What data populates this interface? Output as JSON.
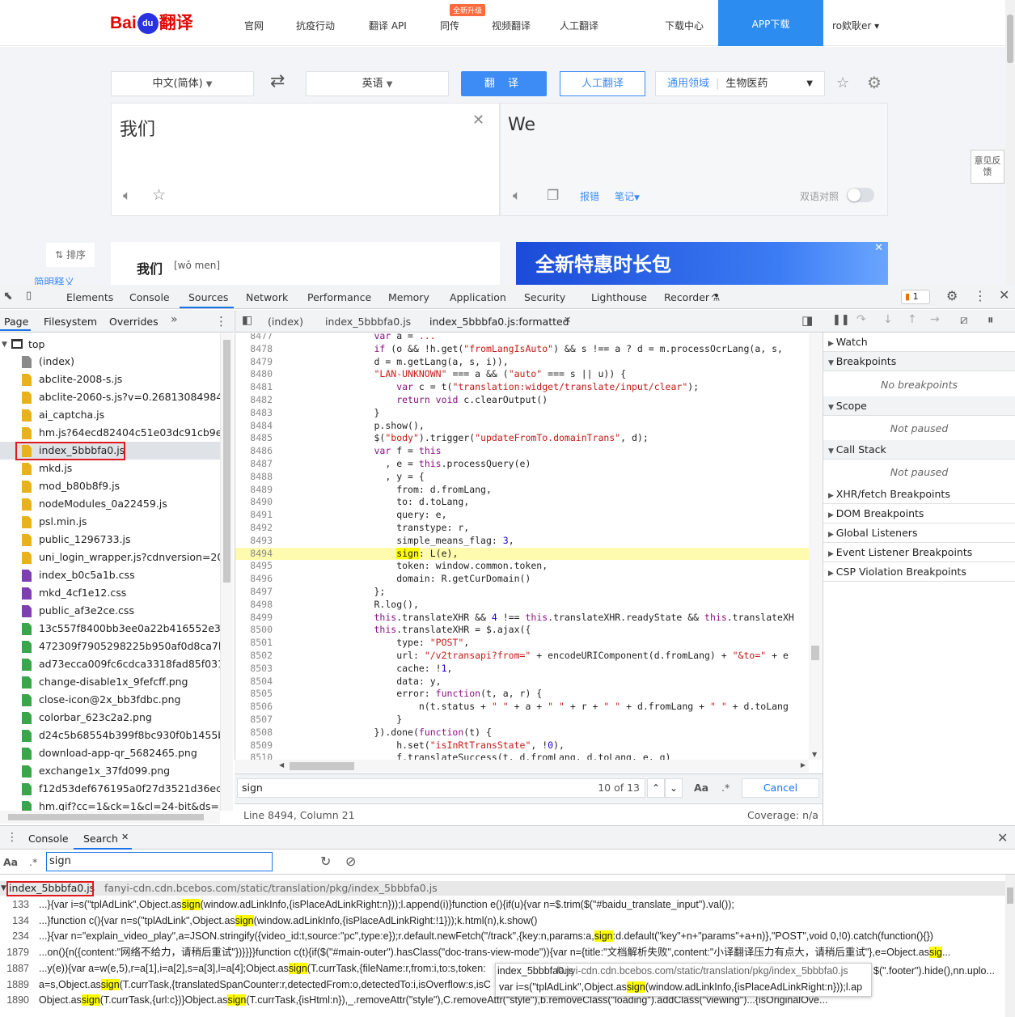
{
  "baidu": {
    "logo_text": "Bai",
    "logo_paw": "du",
    "logo_fanyi": "翻译",
    "nav": [
      "官网",
      "抗疫行动",
      "翻译 API",
      "同传",
      "视频翻译",
      "人工翻译",
      "下载中心"
    ],
    "new_badge": "全新升级",
    "app_download": "APP下载",
    "user": "ro欸耿er",
    "src_lang": "中文(简体)",
    "tgt_lang": "英语",
    "translate_btn": "翻 译",
    "human_btn": "人工翻译",
    "domain_label": "通用领域",
    "domain_value": "生物医药",
    "src_text": "我们",
    "tgt_text": "We",
    "report": "报错",
    "notes": "笔记",
    "bilingual": "双语对照",
    "feedback": "意见反馈",
    "sort": "排序",
    "brief": "简明释义",
    "dict_word": "我们",
    "dict_pinyin": "[wǒ men]",
    "ad_text": "全新特惠时长包"
  },
  "devtools": {
    "tabs": [
      "Elements",
      "Console",
      "Sources",
      "Network",
      "Performance",
      "Memory",
      "Application",
      "Security",
      "Lighthouse",
      "Recorder"
    ],
    "active_tab": "Sources",
    "issues_count": "1",
    "nav_tabs": [
      "Page",
      "Filesystem",
      "Overrides"
    ],
    "tree_root": "top",
    "files": [
      {
        "name": "(index)",
        "type": "doc"
      },
      {
        "name": "abclite-2008-s.js",
        "type": "js"
      },
      {
        "name": "abclite-2060-s.js?v=0.26813084984751",
        "type": "js"
      },
      {
        "name": "ai_captcha.js",
        "type": "js"
      },
      {
        "name": "hm.js?64ecd82404c51e03dc91cb9e8c0",
        "type": "js"
      },
      {
        "name": "index_5bbbfa0.js",
        "type": "js",
        "selected": true
      },
      {
        "name": "mkd.js",
        "type": "js"
      },
      {
        "name": "mod_b80b8f9.js",
        "type": "js"
      },
      {
        "name": "nodeModules_0a22459.js",
        "type": "js"
      },
      {
        "name": "psl.min.js",
        "type": "js"
      },
      {
        "name": "public_1296733.js",
        "type": "js"
      },
      {
        "name": "uni_login_wrapper.js?cdnversion=2022",
        "type": "js"
      },
      {
        "name": "index_b0c5a1b.css",
        "type": "css"
      },
      {
        "name": "mkd_4cf1e12.css",
        "type": "css"
      },
      {
        "name": "public_af3e2ce.css",
        "type": "css"
      },
      {
        "name": "13c557f8400bb3ee0a22b416552e3618",
        "type": "img"
      },
      {
        "name": "472309f7905298225b950af0d8ca7bcb",
        "type": "img"
      },
      {
        "name": "ad73ecca009fc6cdca3318fad85f0314.jp",
        "type": "img"
      },
      {
        "name": "change-disable1x_9fefcff.png",
        "type": "img"
      },
      {
        "name": "close-icon@2x_bb3fdbc.png",
        "type": "img"
      },
      {
        "name": "colorbar_623c2a2.png",
        "type": "img"
      },
      {
        "name": "d24c5b68554b399f8bc930f0b1455b67",
        "type": "img"
      },
      {
        "name": "download-app-qr_5682465.png",
        "type": "img"
      },
      {
        "name": "exchange1x_37fd099.png",
        "type": "img"
      },
      {
        "name": "f12d53def676195a0f27d3521d36ecbb.",
        "type": "img"
      },
      {
        "name": "hm.gif?cc=1&ck=1&cl=24-bit&ds=25",
        "type": "img"
      }
    ],
    "editor_tabs": [
      "(index)",
      "index_5bbbfa0.js",
      "index_5bbbfa0.js:formatted"
    ],
    "code_lines": [
      {
        "n": "8477",
        "html": "<span class='kw'>var</span> a = <span class='str'>...</span>",
        "cut": true
      },
      {
        "n": "8478",
        "html": "<span class='kw'>if</span> (o &amp;&amp; !h.get(<span class='str'>\"fromLangIsAuto\"</span>) &amp;&amp; s !== a ? d = m.processOcrLang(a, s,"
      },
      {
        "n": "8479",
        "html": "d = m.getLang(a, s, i)),"
      },
      {
        "n": "8480",
        "html": "<span class='str'>\"LAN-UNKNOWN\"</span> === a &amp;&amp; (<span class='str'>\"auto\"</span> === s || u)) {"
      },
      {
        "n": "8481",
        "html": "    <span class='kw'>var</span> c = t(<span class='str'>\"translation:widget/translate/input/clear\"</span>);"
      },
      {
        "n": "8482",
        "html": "    <span class='kw'>return void</span> c.clearOutput()"
      },
      {
        "n": "8483",
        "html": "}"
      },
      {
        "n": "8484",
        "html": "p.show(),"
      },
      {
        "n": "8485",
        "html": "$(<span class='str'>\"body\"</span>).trigger(<span class='str'>\"updateFromTo.domainTrans\"</span>, d);"
      },
      {
        "n": "8486",
        "html": "<span class='kw'>var</span> f = <span class='kw'>this</span>"
      },
      {
        "n": "8487",
        "html": "  , e = <span class='kw'>this</span>.processQuery(e)"
      },
      {
        "n": "8488",
        "html": "  , y = {"
      },
      {
        "n": "8489",
        "html": "    from: d.fromLang,"
      },
      {
        "n": "8490",
        "html": "    to: d.toLang,"
      },
      {
        "n": "8491",
        "html": "    query: e,"
      },
      {
        "n": "8492",
        "html": "    transtype: r,"
      },
      {
        "n": "8493",
        "html": "    simple_means_flag: <span class='num'>3</span>,"
      },
      {
        "n": "8494",
        "html": "    <span class='mark'>sign</span>: L(e),",
        "hl": true
      },
      {
        "n": "8495",
        "html": "    token: window.common.token,"
      },
      {
        "n": "8496",
        "html": "    domain: R.getCurDomain()"
      },
      {
        "n": "8497",
        "html": "};"
      },
      {
        "n": "8498",
        "html": "R.log(),"
      },
      {
        "n": "8499",
        "html": "<span class='kw'>this</span>.translateXHR &amp;&amp; <span class='num'>4</span> !== <span class='kw'>this</span>.translateXHR.readyState &amp;&amp; <span class='kw'>this</span>.translateXH"
      },
      {
        "n": "8500",
        "html": "<span class='kw'>this</span>.translateXHR = $.ajax({"
      },
      {
        "n": "8501",
        "html": "    type: <span class='str'>\"POST\"</span>,"
      },
      {
        "n": "8502",
        "html": "    url: <span class='str'>\"/v2transapi?from=\"</span> + encodeURIComponent(d.fromLang) + <span class='str'>\"&amp;to=\"</span> + e"
      },
      {
        "n": "8503",
        "html": "    cache: !<span class='num'>1</span>,"
      },
      {
        "n": "8504",
        "html": "    data: y,"
      },
      {
        "n": "8505",
        "html": "    error: <span class='kw'>function</span>(t, a, r) {"
      },
      {
        "n": "8506",
        "html": "        n(t.status + <span class='str'>\" \"</span> + a + <span class='str'>\" \"</span> + r + <span class='str'>\" \"</span> + d.fromLang + <span class='str'>\" \"</span> + d.toLang"
      },
      {
        "n": "8507",
        "html": "    }"
      },
      {
        "n": "8508",
        "html": "}).done(<span class='kw'>function</span>(t) {"
      },
      {
        "n": "8509",
        "html": "    h.set(<span class='str'>\"isInRtTransState\"</span>, !<span class='num'>0</span>),"
      },
      {
        "n": "8510",
        "html": "    f.translateSuccess(t, d.fromLang, d.toLang, e, g)"
      },
      {
        "n": "8511",
        "html": ""
      }
    ],
    "find_query": "sign",
    "find_count": "10 of 13",
    "find_cancel": "Cancel",
    "status_pos": "Line 8494, Column 21",
    "status_cov": "Coverage: n/a",
    "sections": [
      {
        "label": "Watch",
        "open": false
      },
      {
        "label": "Breakpoints",
        "open": true,
        "note": "No breakpoints"
      },
      {
        "label": "Scope",
        "open": true,
        "note": "Not paused"
      },
      {
        "label": "Call Stack",
        "open": true,
        "note": "Not paused"
      },
      {
        "label": "XHR/fetch Breakpoints",
        "open": false
      },
      {
        "label": "DOM Breakpoints",
        "open": false
      },
      {
        "label": "Global Listeners",
        "open": false
      },
      {
        "label": "Event Listener Breakpoints",
        "open": false
      },
      {
        "label": "CSP Violation Breakpoints",
        "open": false
      }
    ],
    "drawer_tabs": [
      "Console",
      "Search"
    ],
    "search_query": "sign",
    "result_file": "index_5bbbfa0.js",
    "result_url": "fanyi-cdn.cdn.bcebos.com/static/translation/pkg/index_5bbbfa0.js",
    "results": [
      {
        "n": "133",
        "html": "...}{var i=s(\"tplAdLink\",Object.as<span class='mark'>sign</span>(window.adLinkInfo,{isPlaceAdLinkRight:n}));l.append(i)}function e(){if(u){var n=$.trim($(\"#baidu_translate_input\").val());"
      },
      {
        "n": "134",
        "html": "...}function c(){var n=s(\"tplAdLink\",Object.as<span class='mark'>sign</span>(window.adLinkInfo,{isPlaceAdLinkRight:!1}));k.html(n),k.show()"
      },
      {
        "n": "234",
        "html": "...}{var n=\"explain_video_play\",a=JSON.stringify({video_id:t,source:\"pc\",type:e});r.default.newFetch(\"/track\",{key:n,params:a,<span class='mark'>sign</span>:d.default(\"key\"+n+\"params\"+a+n)},\"POST\",void 0,!0).catch(function(){})"
      },
      {
        "n": "1879",
        "html": "...on(){n({content:\"网络不给力，请稍后重试\"})}}}}function c(t){if($(\"#main-outer\").hasClass(\"doc-trans-view-mode\")){var n={title:\"文档解析失败\",content:\"小译翻译压力有点大，请稍后重试\"},e=Object.as<span class='mark'>sig</span>..."
      },
      {
        "n": "1887",
        "html": "...y(e)){var a=w(e,5),r=a[1],i=a[2],s=a[3],l=a[4];Object.as<span class='mark'>sign</span>(T.currTask,{fileName:r,from:i,to:s,token:"
      },
      {
        "n": "1889",
        "html": "a=s,Object.as<span class='mark'>sign</span>(T.currTask,{translatedSpanCounter:r,detectedFrom:o,detectedTo:i,isOverflow:s,isC"
      },
      {
        "n": "1890",
        "html": "Object.as<span class='mark'>sign</span>(T.currTask,{url:c})}Object.as<span class='mark'>sign</span>(T.currTask,{isHtml:n}),_.removeAttr(\"style\"),C.removeAttr(\"style\"),b.removeClass(\"loading\").addClass(\"viewing\")...{isOriginalOve..."
      }
    ],
    "tooltip_file": "index_5bbbfa0.js",
    "tooltip_url": "fanyi-cdn.cdn.bcebos.com/static/translation/pkg/index_5bbbfa0.js",
    "tooltip_code": "var i=s(\"tplAdLink\",Object.as<span class='mark'>sign</span>(window.adLinkInfo,{isPlaceAdLinkRight:n}));l.ap",
    "r1887_tail": "$(\".footer\").hide(),nn.uplo..."
  },
  "colors": {
    "baidu_red": "#e10602",
    "baidu_blue": "#2932e1",
    "accent": "#1a73e8",
    "highlight": "#fdfd00",
    "redbox": "#e0191f"
  }
}
